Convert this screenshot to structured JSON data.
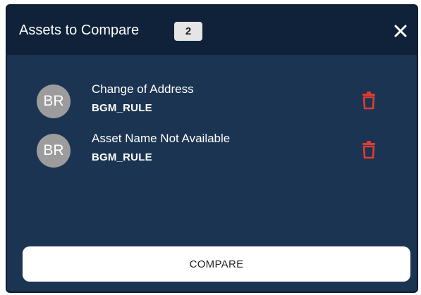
{
  "dialog": {
    "title": "Assets to Compare",
    "count": "2",
    "close_icon": "close-icon"
  },
  "assets": [
    {
      "initials": "BR",
      "name": "Change of Address",
      "type": "BGM_RULE",
      "delete_icon": "trash-icon"
    },
    {
      "initials": "BR",
      "name": "Asset Name Not Available",
      "type": "BGM_RULE",
      "delete_icon": "trash-icon"
    }
  ],
  "footer": {
    "compare_label": "COMPARE"
  },
  "colors": {
    "panel_background": "#1b3452",
    "header_background": "#0f223a",
    "avatar_background": "#9c9c9c",
    "delete_icon": "#e03c31",
    "badge_background": "#e5e5e5"
  }
}
